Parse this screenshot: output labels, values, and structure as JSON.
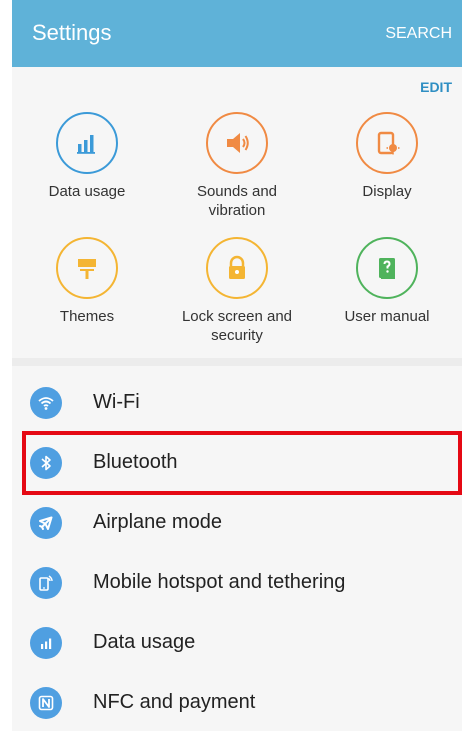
{
  "appbar": {
    "title": "Settings",
    "search_label": "SEARCH"
  },
  "quick_settings": {
    "edit_label": "EDIT",
    "items": [
      {
        "label": "Data usage",
        "icon": "data-usage-icon",
        "color": "#3b9ad8"
      },
      {
        "label": "Sounds and\nvibration",
        "icon": "speaker-icon",
        "color": "#f08a43"
      },
      {
        "label": "Display",
        "icon": "display-icon",
        "color": "#f08a43"
      },
      {
        "label": "Themes",
        "icon": "paint-roller-icon",
        "color": "#f4b533"
      },
      {
        "label": "Lock screen and\nsecurity",
        "icon": "lock-icon",
        "color": "#f4b533"
      },
      {
        "label": "User manual",
        "icon": "book-icon",
        "color": "#4fb35c"
      }
    ]
  },
  "settings_list": {
    "items": [
      {
        "label": "Wi-Fi",
        "icon": "wifi-icon"
      },
      {
        "label": "Bluetooth",
        "icon": "bluetooth-icon"
      },
      {
        "label": "Airplane mode",
        "icon": "airplane-icon"
      },
      {
        "label": "Mobile hotspot and tethering",
        "icon": "hotspot-icon"
      },
      {
        "label": "Data usage",
        "icon": "data-usage-icon"
      },
      {
        "label": "NFC and payment",
        "icon": "nfc-icon"
      }
    ],
    "icon_color": "#4f9fe1"
  },
  "highlight": {
    "target": "Bluetooth",
    "color": "#e50914"
  }
}
